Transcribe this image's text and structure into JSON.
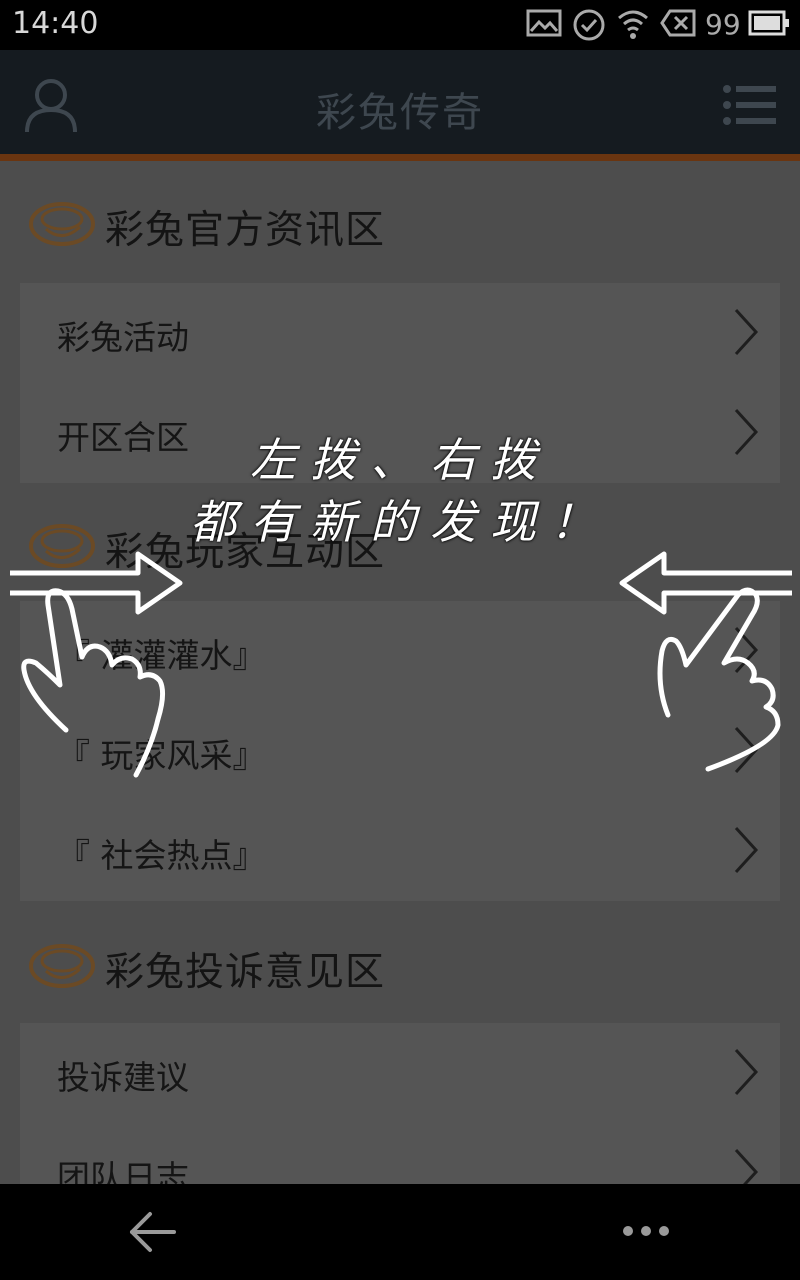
{
  "status_bar": {
    "time": "14:40",
    "battery_percent": "99",
    "icons": [
      "image-icon",
      "check-circle-icon",
      "wifi-icon",
      "sim-error-icon",
      "battery-icon"
    ]
  },
  "app_bar": {
    "title": "彩兔传奇",
    "left_icon": "user-icon",
    "right_icon": "menu-list-icon"
  },
  "sections": [
    {
      "title": "彩兔官方资讯区",
      "items": [
        "彩兔活动",
        "开区合区"
      ]
    },
    {
      "title": "彩兔玩家互动区",
      "items": [
        "『 灌灌灌水』",
        "『 玩家风采』",
        "『 社会热点』"
      ]
    },
    {
      "title": "彩兔投诉意见区",
      "items": [
        "投诉建议",
        "团队日志"
      ]
    }
  ],
  "overlay_hint": {
    "line1": "左拨、右拨",
    "line2": "都有新的发现！"
  },
  "nav_bar": {
    "back_icon": "back-arrow-icon",
    "more_icon": "more-dots-icon"
  },
  "colors": {
    "overlay_dim": "#4d4d4d",
    "accent_strip": "#6a3510",
    "logo_orange": "#c07020"
  }
}
